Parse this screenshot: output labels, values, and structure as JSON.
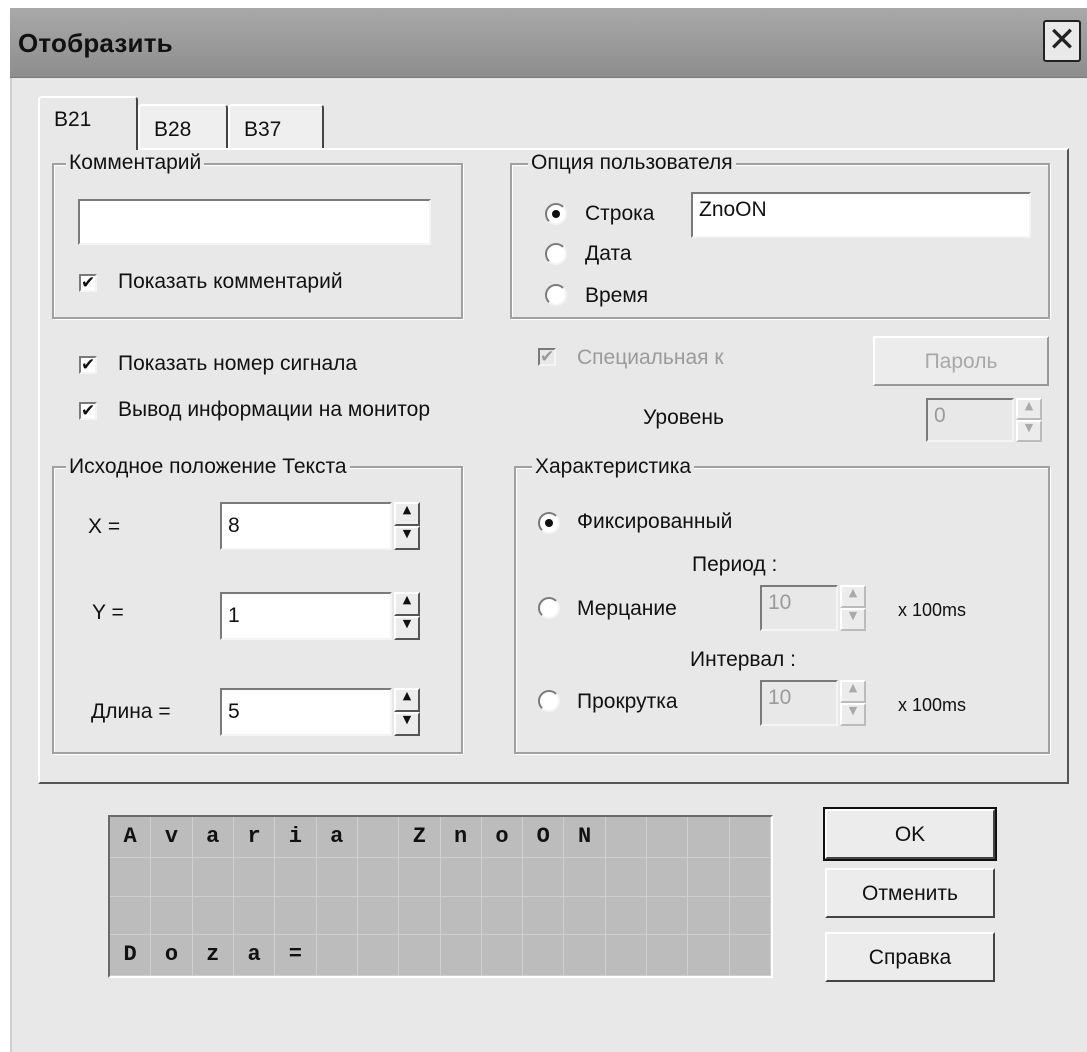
{
  "window": {
    "title": "Отобразить",
    "close_glyph": "✕"
  },
  "tabs": [
    {
      "label": "B21",
      "active": true
    },
    {
      "label": "B28",
      "active": false
    },
    {
      "label": "B37",
      "active": false
    }
  ],
  "comment_group": {
    "legend": "Комментарий",
    "value": "",
    "show_comment_label": "Показать комментарий",
    "show_comment_checked": true
  },
  "user_option_group": {
    "legend": "Опция пользователя",
    "radio_string": "Строка",
    "radio_date": "Дата",
    "radio_time": "Время",
    "selected": "Строка",
    "string_value": "ZnoON"
  },
  "options": {
    "show_signal_number": "Показать номер сигнала",
    "show_signal_number_checked": true,
    "monitor_output": "Вывод информации на монитор",
    "monitor_output_checked": true,
    "special_label": "Специальная к",
    "special_checked": true,
    "password_button": "Пароль",
    "level_label": "Уровень",
    "level_value": "0"
  },
  "text_position_group": {
    "legend": "Исходное положение Текста",
    "x_label": "X =",
    "x_value": "8",
    "y_label": "Y =",
    "y_value": "1",
    "length_label": "Длина =",
    "length_value": "5"
  },
  "characteristic_group": {
    "legend": "Характеристика",
    "fixed_label": "Фиксированный",
    "period_label": "Период :",
    "blink_label": "Мерцание",
    "blink_value": "10",
    "blink_unit": "x 100ms",
    "interval_label": "Интервал :",
    "scroll_label": "Прокрутка",
    "scroll_value": "10",
    "scroll_unit": "x 100ms",
    "selected": "Фиксированный"
  },
  "preview": {
    "rows": [
      [
        "A",
        "v",
        "a",
        "r",
        "i",
        "a",
        "",
        "Z",
        "n",
        "o",
        "O",
        "N",
        "",
        "",
        "",
        ""
      ],
      [
        "",
        "",
        "",
        "",
        "",
        "",
        "",
        "",
        "",
        "",
        "",
        "",
        "",
        "",
        "",
        ""
      ],
      [
        "",
        "",
        "",
        "",
        "",
        "",
        "",
        "",
        "",
        "",
        "",
        "",
        "",
        "",
        "",
        ""
      ],
      [
        "D",
        "o",
        "z",
        "a",
        "=",
        "",
        "",
        "",
        "",
        "",
        "",
        "",
        "",
        "",
        "",
        ""
      ]
    ]
  },
  "buttons": {
    "ok": "OK",
    "cancel": "Отменить",
    "help": "Справка"
  },
  "icons": {
    "up_arrow": "▲",
    "down_arrow": "▼",
    "check_mark": "✔"
  }
}
